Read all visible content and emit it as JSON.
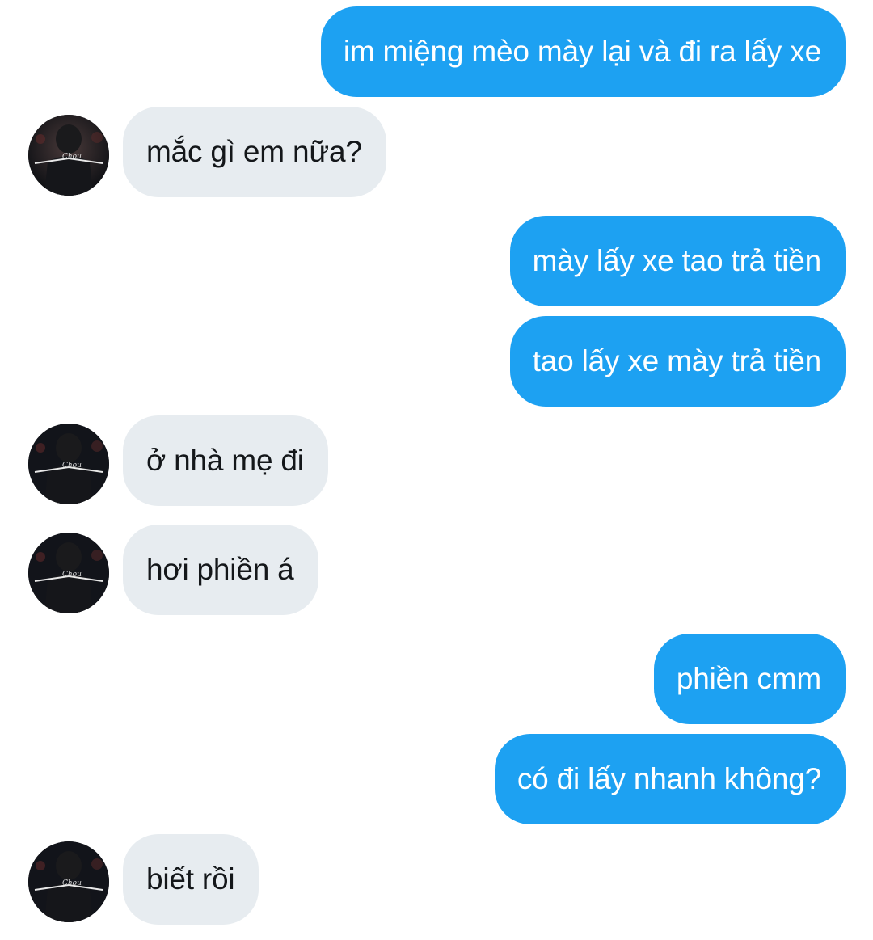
{
  "conversation": {
    "messages": [
      {
        "id": "m1",
        "sender": "self",
        "text": "im miệng mèo mày lại và đi ra lấy xe"
      },
      {
        "id": "m2",
        "sender": "other",
        "text": "mắc gì em nữa?"
      },
      {
        "id": "m3",
        "sender": "self",
        "text": "mày lấy xe tao trả tiền"
      },
      {
        "id": "m4",
        "sender": "self",
        "text": "tao lấy xe mày trả tiền"
      },
      {
        "id": "m5",
        "sender": "other",
        "text": "ở nhà mẹ đi"
      },
      {
        "id": "m6",
        "sender": "other",
        "text": "hơi phiền á"
      },
      {
        "id": "m7",
        "sender": "self",
        "text": "phiền cmm"
      },
      {
        "id": "m8",
        "sender": "self",
        "text": "có đi lấy nhanh không?"
      },
      {
        "id": "m9",
        "sender": "other",
        "text": "biết rồi"
      }
    ]
  },
  "avatar": {
    "icon": "user-avatar-photo",
    "shirt_text": "Chou"
  },
  "colors": {
    "outgoing_bubble": "#1da1f2",
    "outgoing_text": "#ffffff",
    "incoming_bubble": "#e7ecf0",
    "incoming_text": "#14171a",
    "background": "#ffffff"
  }
}
